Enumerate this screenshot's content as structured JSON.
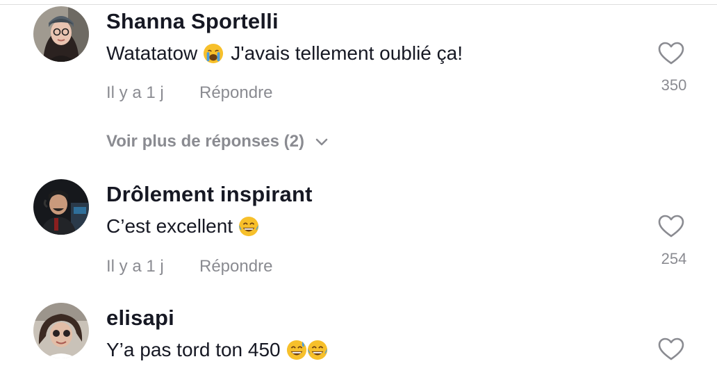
{
  "comments": [
    {
      "username": "Shanna Sportelli",
      "text": "Watatatow",
      "emoji_after_text": [
        "crying-face-emoji"
      ],
      "text_suffix": "J'avais tellement oublié ça!",
      "time": "Il y a 1 j",
      "reply_label": "Répondre",
      "likes": "350"
    },
    {
      "username": "Drôlement inspirant",
      "text": "C’est excellent",
      "emoji_after_text": [
        "tears-of-joy-emoji"
      ],
      "time": "Il y a 1 j",
      "reply_label": "Répondre",
      "likes": "254"
    },
    {
      "username": "elisapi",
      "text": "Y’a pas tord ton 450",
      "emoji_after_text": [
        "grinning-sweat-emoji",
        "tears-of-joy-emoji"
      ]
    }
  ],
  "more_replies": {
    "label": "Voir plus de réponses (2)"
  },
  "colors": {
    "text_primary": "#161823",
    "text_secondary": "#8a8b91",
    "emoji_yellow": "#f7c02b",
    "emoji_tear": "#4a9de0"
  },
  "icons": {
    "like": "heart-outline-icon",
    "expand": "chevron-down-icon"
  }
}
